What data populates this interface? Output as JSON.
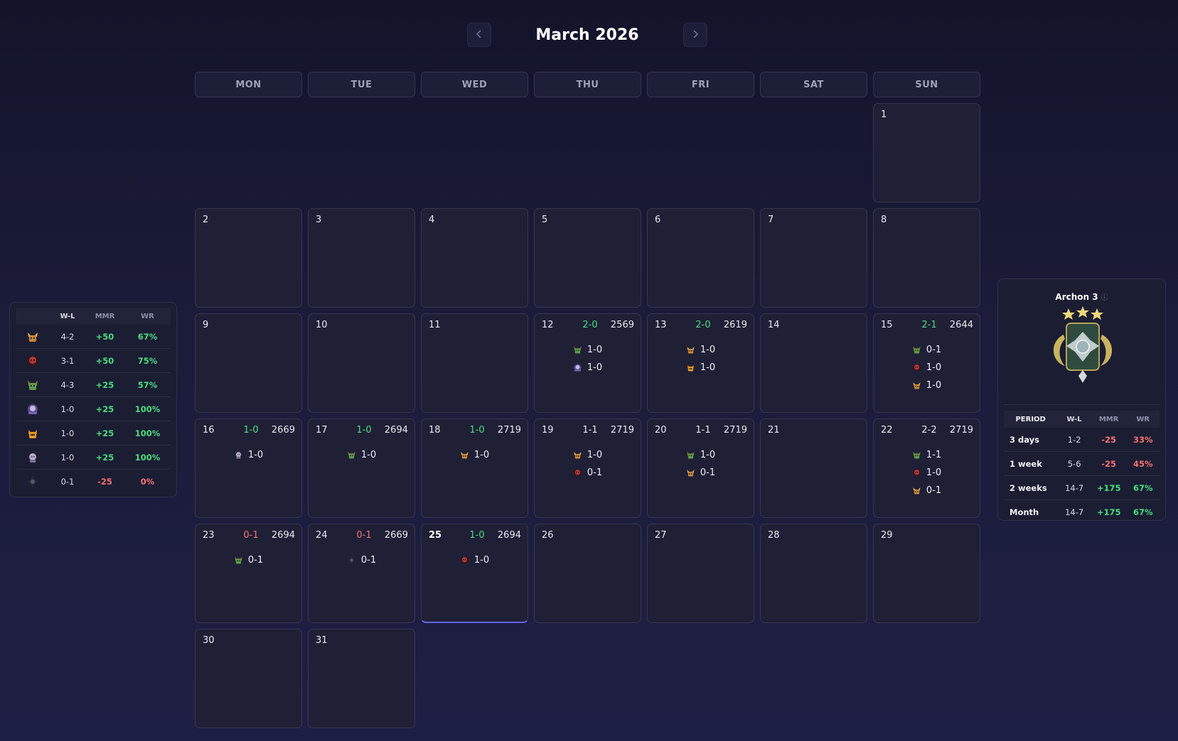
{
  "header": {
    "title": "March 2026",
    "prev_icon": "chevron-left-icon",
    "next_icon": "chevron-right-icon"
  },
  "weekdays": [
    "MON",
    "TUE",
    "WED",
    "THU",
    "FRI",
    "SAT",
    "SUN"
  ],
  "colors": {
    "positive": "#4ade80",
    "negative": "#f87171",
    "accent": "#6366f1"
  },
  "days": [
    {
      "day": "1",
      "record": "",
      "mmr": "",
      "games": []
    },
    {
      "day": "2",
      "record": "",
      "mmr": "",
      "games": []
    },
    {
      "day": "3",
      "record": "",
      "mmr": "",
      "games": []
    },
    {
      "day": "4",
      "record": "",
      "mmr": "",
      "games": []
    },
    {
      "day": "5",
      "record": "",
      "mmr": "",
      "games": []
    },
    {
      "day": "6",
      "record": "",
      "mmr": "",
      "games": []
    },
    {
      "day": "7",
      "record": "",
      "mmr": "",
      "games": []
    },
    {
      "day": "8",
      "record": "",
      "mmr": "",
      "games": []
    },
    {
      "day": "9",
      "record": "",
      "mmr": "",
      "games": []
    },
    {
      "day": "10",
      "record": "",
      "mmr": "",
      "games": []
    },
    {
      "day": "11",
      "record": "",
      "mmr": "",
      "games": []
    },
    {
      "day": "12",
      "record": "2-0",
      "mmr": "2569",
      "games": [
        {
          "hero": "green-hero",
          "result": "1-0"
        },
        {
          "hero": "purple-hero",
          "result": "1-0"
        }
      ]
    },
    {
      "day": "13",
      "record": "2-0",
      "mmr": "2619",
      "games": [
        {
          "hero": "horned-gold-hero",
          "result": "1-0"
        },
        {
          "hero": "orange-hero",
          "result": "1-0"
        }
      ]
    },
    {
      "day": "14",
      "record": "",
      "mmr": "",
      "games": []
    },
    {
      "day": "15",
      "record": "2-1",
      "mmr": "2644",
      "games": [
        {
          "hero": "green-hero",
          "result": "0-1"
        },
        {
          "hero": "red-hero",
          "result": "1-0"
        },
        {
          "hero": "horned-gold-hero",
          "result": "1-0"
        }
      ]
    },
    {
      "day": "16",
      "record": "1-0",
      "mmr": "2669",
      "games": [
        {
          "hero": "pale-hero",
          "result": "1-0"
        }
      ]
    },
    {
      "day": "17",
      "record": "1-0",
      "mmr": "2694",
      "games": [
        {
          "hero": "green-hero",
          "result": "1-0"
        }
      ]
    },
    {
      "day": "18",
      "record": "1-0",
      "mmr": "2719",
      "games": [
        {
          "hero": "horned-gold-hero",
          "result": "1-0"
        }
      ]
    },
    {
      "day": "19",
      "record": "1-1",
      "mmr": "2719",
      "games": [
        {
          "hero": "horned-gold-hero",
          "result": "1-0"
        },
        {
          "hero": "red-hero",
          "result": "0-1"
        }
      ]
    },
    {
      "day": "20",
      "record": "1-1",
      "mmr": "2719",
      "games": [
        {
          "hero": "green-hero",
          "result": "1-0"
        },
        {
          "hero": "horned-gold-hero",
          "result": "0-1"
        }
      ]
    },
    {
      "day": "21",
      "record": "",
      "mmr": "",
      "games": []
    },
    {
      "day": "22",
      "record": "2-2",
      "mmr": "2719",
      "games": [
        {
          "hero": "green-hero",
          "result": "1-1"
        },
        {
          "hero": "red-hero",
          "result": "1-0"
        },
        {
          "hero": "horned-gold-hero",
          "result": "0-1"
        }
      ]
    },
    {
      "day": "23",
      "record": "0-1",
      "mmr": "2694",
      "games": [
        {
          "hero": "green-hero",
          "result": "0-1"
        }
      ]
    },
    {
      "day": "24",
      "record": "0-1",
      "mmr": "2669",
      "games": [
        {
          "hero": "dark-hero",
          "result": "0-1"
        }
      ]
    },
    {
      "day": "25",
      "record": "1-0",
      "mmr": "2694",
      "games": [
        {
          "hero": "red-hero",
          "result": "1-0"
        }
      ]
    },
    {
      "day": "26",
      "record": "",
      "mmr": "",
      "games": []
    },
    {
      "day": "27",
      "record": "",
      "mmr": "",
      "games": []
    },
    {
      "day": "28",
      "record": "",
      "mmr": "",
      "games": []
    },
    {
      "day": "29",
      "record": "",
      "mmr": "",
      "games": []
    },
    {
      "day": "30",
      "record": "",
      "mmr": "",
      "games": []
    },
    {
      "day": "31",
      "record": "",
      "mmr": "",
      "games": []
    }
  ],
  "today": "25",
  "hero_stats": {
    "headers": [
      "",
      "W-L",
      "MMR",
      "WR"
    ],
    "rows": [
      {
        "hero": "horned-gold-hero",
        "wl": "4-2",
        "mmr": "+50",
        "wr": "67%"
      },
      {
        "hero": "red-hero",
        "wl": "3-1",
        "mmr": "+50",
        "wr": "75%"
      },
      {
        "hero": "green-hero",
        "wl": "4-3",
        "mmr": "+25",
        "wr": "57%"
      },
      {
        "hero": "purple-hero",
        "wl": "1-0",
        "mmr": "+25",
        "wr": "100%"
      },
      {
        "hero": "orange-hero",
        "wl": "1-0",
        "mmr": "+25",
        "wr": "100%"
      },
      {
        "hero": "pale-hero",
        "wl": "1-0",
        "mmr": "+25",
        "wr": "100%"
      },
      {
        "hero": "dark-hero",
        "wl": "0-1",
        "mmr": "-25",
        "wr": "0%"
      }
    ]
  },
  "rank": {
    "name": "Archon 3",
    "info_icon": "info-icon",
    "medal_icon": "archon-medal-icon",
    "stars": 3,
    "headers": [
      "PERIOD",
      "W-L",
      "MMR",
      "WR"
    ],
    "rows": [
      {
        "period": "3 days",
        "wl": "1-2",
        "mmr": "-25",
        "wr": "33%"
      },
      {
        "period": "1 week",
        "wl": "5-6",
        "mmr": "-25",
        "wr": "45%"
      },
      {
        "period": "2 weeks",
        "wl": "14-7",
        "mmr": "+175",
        "wr": "67%"
      },
      {
        "period": "Month",
        "wl": "14-7",
        "mmr": "+175",
        "wr": "67%"
      }
    ]
  }
}
